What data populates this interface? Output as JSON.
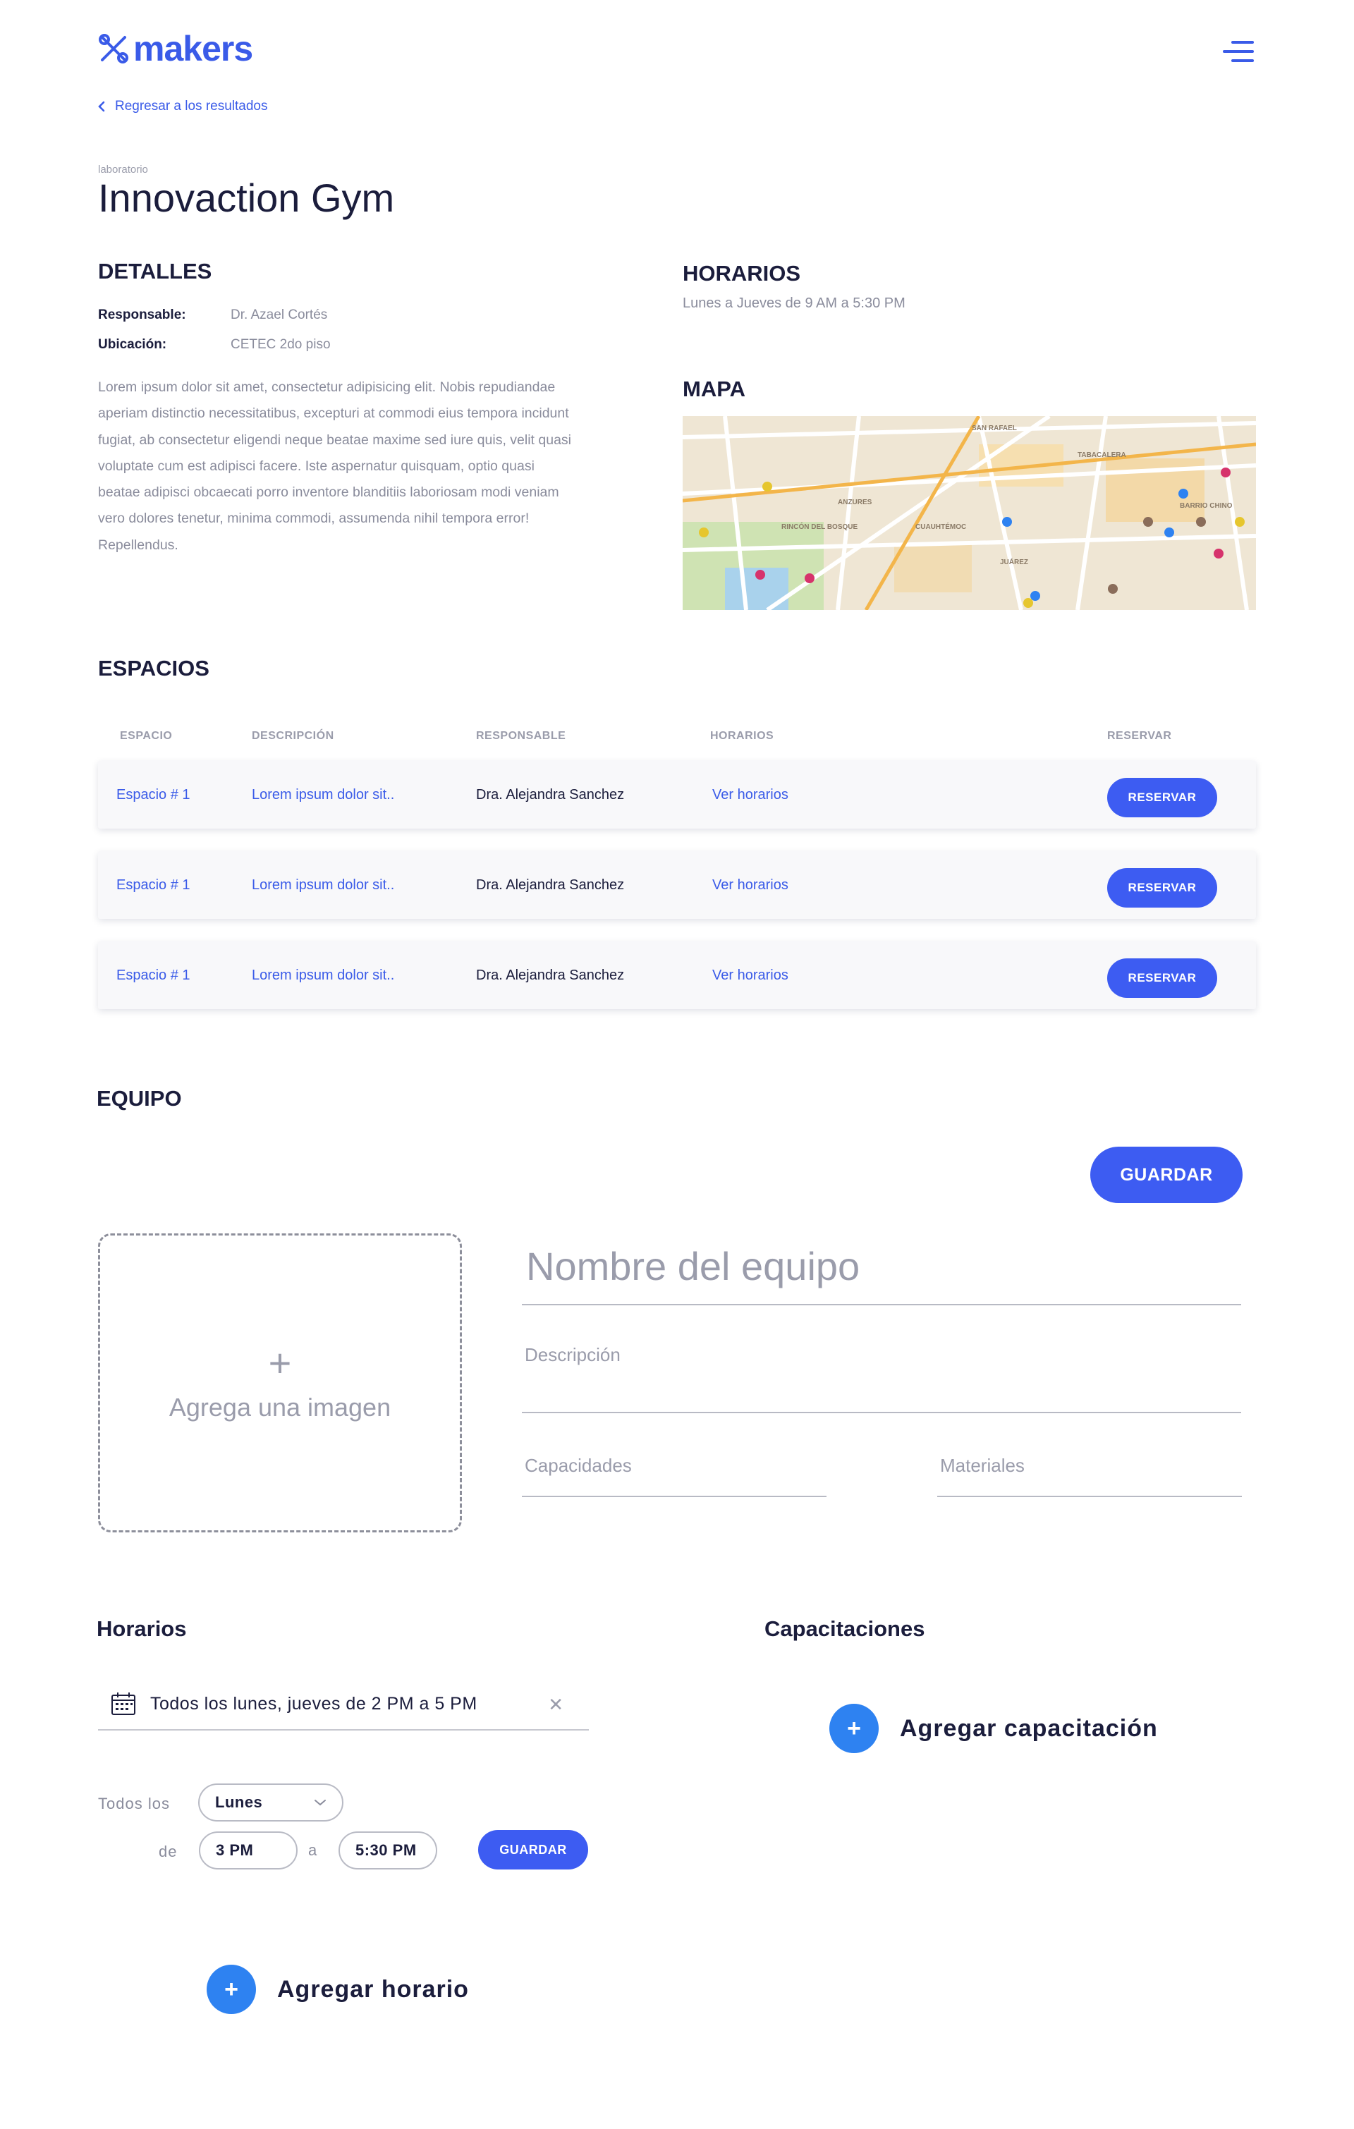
{
  "brand": {
    "name": "makers",
    "accent": "#3a5be8",
    "button": "#3d5cf2",
    "add_button": "#2e82f1"
  },
  "nav": {
    "back_label": "Regresar a los resultados",
    "menu_icon": "hamburger-icon"
  },
  "lab": {
    "category": "laboratorio",
    "title": "Innovaction Gym"
  },
  "details": {
    "heading": "DETALLES",
    "responsable_label": "Responsable:",
    "responsable_value": "Dr. Azael Cortés",
    "ubicacion_label": "Ubicación:",
    "ubicacion_value": "CETEC 2do piso",
    "description": "Lorem ipsum dolor sit amet, consectetur adipisicing elit. Nobis repudiandae aperiam distinctio necessitatibus, excepturi at commodi eius tempora incidunt fugiat, ab consectetur eligendi neque beatae maxime sed iure quis, velit quasi voluptate cum est adipisci facere. Iste aspernatur quisquam, optio quasi beatae adipisci obcaecati porro inventore blanditiis laboriosam modi veniam vero dolores tenetur, minima commodi, assumenda nihil tempora error! Repellendus."
  },
  "hours": {
    "heading": "HORARIOS",
    "text": "Lunes a Jueves de 9 AM a 5:30 PM"
  },
  "map": {
    "heading": "MAPA",
    "labels": [
      "SAN RAFAEL",
      "TABACALERA",
      "ANZURES",
      "RINCÓN DEL BOSQUE",
      "CUAUHTÉMOC",
      "JUÁREZ",
      "BARRIO CHINO"
    ]
  },
  "spaces": {
    "heading": "ESPACIOS",
    "columns": [
      "ESPACIO",
      "DESCRIPCIÓN",
      "RESPONSABLE",
      "HORARIOS",
      "RESERVAR"
    ],
    "rows": [
      {
        "espacio": "Espacio # 1",
        "descripcion": "Lorem ipsum dolor sit..",
        "responsable": "Dra. Alejandra Sanchez",
        "horarios": "Ver horarios",
        "action": "RESERVAR"
      },
      {
        "espacio": "Espacio # 1",
        "descripcion": "Lorem ipsum dolor sit..",
        "responsable": "Dra. Alejandra Sanchez",
        "horarios": "Ver horarios",
        "action": "RESERVAR"
      },
      {
        "espacio": "Espacio # 1",
        "descripcion": "Lorem ipsum dolor sit..",
        "responsable": "Dra. Alejandra Sanchez",
        "horarios": "Ver horarios",
        "action": "RESERVAR"
      }
    ]
  },
  "equipment": {
    "heading": "EQUIPO",
    "save_label": "GUARDAR",
    "image_placeholder": "Agrega una imagen",
    "name_placeholder": "Nombre del equipo",
    "description_placeholder": "Descripción",
    "capacities_placeholder": "Capacidades",
    "materials_placeholder": "Materiales"
  },
  "schedules": {
    "heading": "Horarios",
    "entry": "Todos los lunes, jueves de 2 PM a 5 PM",
    "every_label": "Todos los",
    "day_value": "Lunes",
    "from_label": "de",
    "from_value": "3 PM",
    "to_label": "a",
    "to_value": "5:30 PM",
    "save_label": "GUARDAR",
    "add_label": "Agregar horario"
  },
  "trainings": {
    "heading": "Capacitaciones",
    "add_label": "Agregar capacitación"
  }
}
